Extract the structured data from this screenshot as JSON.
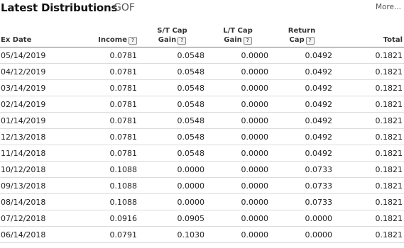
{
  "header": {
    "title": "Latest Distributions",
    "ticker": "GOF",
    "more_label": "More..."
  },
  "table": {
    "columns": {
      "ex_date": "Ex Date",
      "income": "Income",
      "st_cap_line1": "S/T Cap",
      "st_cap_line2": "Gain",
      "lt_cap_line1": "L/T Cap",
      "lt_cap_line2": "Gain",
      "return_cap_line1": "Return",
      "return_cap_line2": "Cap",
      "total": "Total"
    },
    "help_glyph": "?",
    "rows": [
      {
        "ex_date": "05/14/2019",
        "income": "0.0781",
        "st_cap_gain": "0.0548",
        "lt_cap_gain": "0.0000",
        "return_cap": "0.0492",
        "total": "0.1821"
      },
      {
        "ex_date": "04/12/2019",
        "income": "0.0781",
        "st_cap_gain": "0.0548",
        "lt_cap_gain": "0.0000",
        "return_cap": "0.0492",
        "total": "0.1821"
      },
      {
        "ex_date": "03/14/2019",
        "income": "0.0781",
        "st_cap_gain": "0.0548",
        "lt_cap_gain": "0.0000",
        "return_cap": "0.0492",
        "total": "0.1821"
      },
      {
        "ex_date": "02/14/2019",
        "income": "0.0781",
        "st_cap_gain": "0.0548",
        "lt_cap_gain": "0.0000",
        "return_cap": "0.0492",
        "total": "0.1821"
      },
      {
        "ex_date": "01/14/2019",
        "income": "0.0781",
        "st_cap_gain": "0.0548",
        "lt_cap_gain": "0.0000",
        "return_cap": "0.0492",
        "total": "0.1821"
      },
      {
        "ex_date": "12/13/2018",
        "income": "0.0781",
        "st_cap_gain": "0.0548",
        "lt_cap_gain": "0.0000",
        "return_cap": "0.0492",
        "total": "0.1821"
      },
      {
        "ex_date": "11/14/2018",
        "income": "0.0781",
        "st_cap_gain": "0.0548",
        "lt_cap_gain": "0.0000",
        "return_cap": "0.0492",
        "total": "0.1821"
      },
      {
        "ex_date": "10/12/2018",
        "income": "0.1088",
        "st_cap_gain": "0.0000",
        "lt_cap_gain": "0.0000",
        "return_cap": "0.0733",
        "total": "0.1821"
      },
      {
        "ex_date": "09/13/2018",
        "income": "0.1088",
        "st_cap_gain": "0.0000",
        "lt_cap_gain": "0.0000",
        "return_cap": "0.0733",
        "total": "0.1821"
      },
      {
        "ex_date": "08/14/2018",
        "income": "0.1088",
        "st_cap_gain": "0.0000",
        "lt_cap_gain": "0.0000",
        "return_cap": "0.0733",
        "total": "0.1821"
      },
      {
        "ex_date": "07/12/2018",
        "income": "0.0916",
        "st_cap_gain": "0.0905",
        "lt_cap_gain": "0.0000",
        "return_cap": "0.0000",
        "total": "0.1821"
      },
      {
        "ex_date": "06/14/2018",
        "income": "0.0791",
        "st_cap_gain": "0.1030",
        "lt_cap_gain": "0.0000",
        "return_cap": "0.0000",
        "total": "0.1821"
      }
    ]
  }
}
